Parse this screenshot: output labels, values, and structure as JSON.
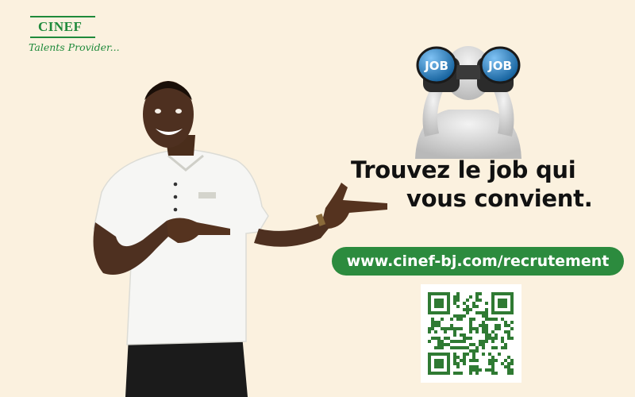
{
  "brand": {
    "name": "CINEF",
    "tagline": "Talents Provider..."
  },
  "binoculars": {
    "left_label": "JOB",
    "right_label": "JOB"
  },
  "headline": {
    "line1": "Trouvez le job qui",
    "line2": "vous convient."
  },
  "url": "www.cinef-bj.com/recrutement",
  "colors": {
    "background": "#fbf1df",
    "brand_green": "#1f8a3b",
    "pill_green": "#2c8b3e",
    "qr_green": "#2f7a33",
    "binocular_blue": "#1e74b8"
  },
  "icons": {
    "qr": "qr-code",
    "figure": "binocular-figure"
  }
}
